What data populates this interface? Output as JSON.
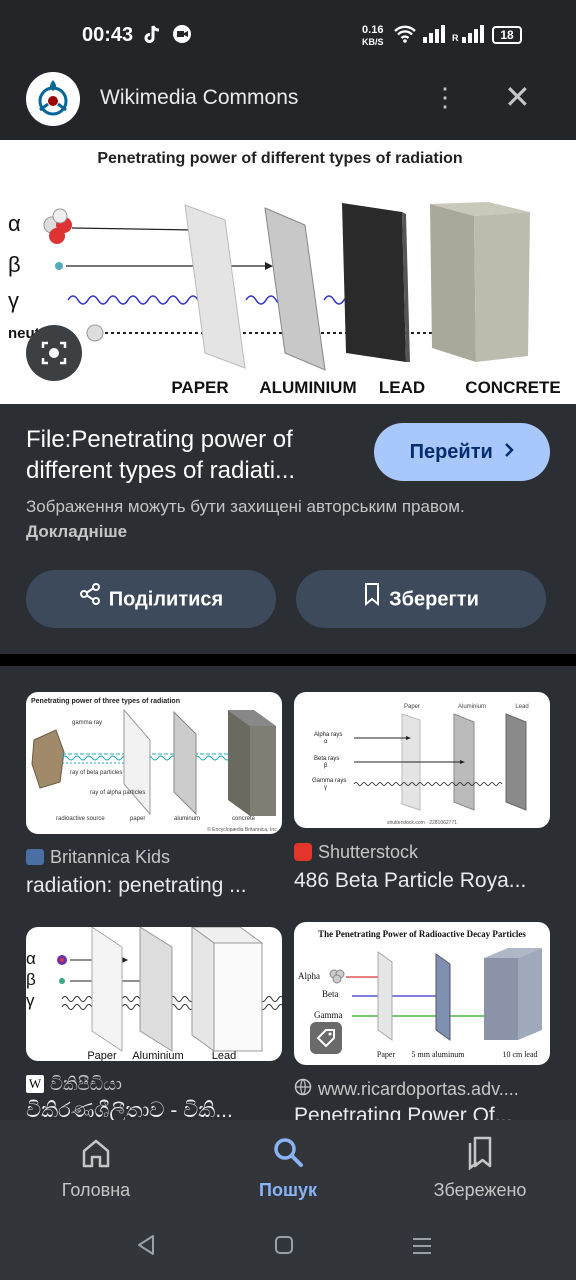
{
  "status_bar": {
    "time": "00:43",
    "net_speed": "0.16",
    "net_unit": "KB/S",
    "battery": "18"
  },
  "header": {
    "title": "Wikimedia Commons",
    "more_icon": "more-vert-icon",
    "close_icon": "close-icon"
  },
  "preview": {
    "title": "Penetrating power of different types of radiation",
    "rows": [
      "α",
      "β",
      "γ",
      "neutron"
    ],
    "labels": [
      "PAPER",
      "ALUMINIUM",
      "LEAD",
      "CONCRETE"
    ]
  },
  "info": {
    "title_line1": "File:Penetrating power of",
    "title_line2": "different types of radiati...",
    "go_button": "Перейти",
    "copyright_text": "Зображення можуть бути захищені авторським правом.",
    "copyright_link": "Докладніше"
  },
  "actions": {
    "share": "Поділитися",
    "save": "Зберегти"
  },
  "related": [
    {
      "source": "Britannica Kids",
      "desc": "radiation: penetrating ...",
      "thumb_title": "Penetrating power of three types of radiation",
      "thumb_labels": [
        "gamma ray",
        "ray of beta particles",
        "ray of alpha particles",
        "radioactive source",
        "paper",
        "aluminum",
        "concrete"
      ],
      "credit": "© Encyclopædia Britannica, Inc."
    },
    {
      "source": "Shutterstock",
      "desc": "486 Beta Particle Roya...",
      "thumb_labels": [
        "Paper",
        "Aluminium",
        "Lead",
        "Alpha rays",
        "α",
        "Beta rays",
        "β",
        "Gamma rays",
        "γ"
      ],
      "credit": "shutterstock.com · 2281062771"
    },
    {
      "source": "විකිපීඩියා",
      "desc": "විකිරණශීලීතාව - විකි...",
      "thumb_labels": [
        "α",
        "β",
        "γ",
        "Paper",
        "Aluminium",
        "Lead"
      ]
    },
    {
      "source": "www.ricardoportas.adv....",
      "desc": "Penetrating Power Of...",
      "thumb_title": "The Penetrating Power of Radioactive Decay Particles",
      "thumb_labels": [
        "Alpha",
        "Beta",
        "Gamma",
        "Paper",
        "5 mm aluminum",
        "10 cm lead"
      ]
    }
  ],
  "bottom_nav": [
    {
      "label": "Головна",
      "icon": "home-icon"
    },
    {
      "label": "Пошук",
      "icon": "search-icon"
    },
    {
      "label": "Збережено",
      "icon": "bookmarks-icon"
    }
  ],
  "colors": {
    "accent": "#a8c7fa",
    "active_nav": "#8ab4f8",
    "background": "#2b2e33"
  }
}
